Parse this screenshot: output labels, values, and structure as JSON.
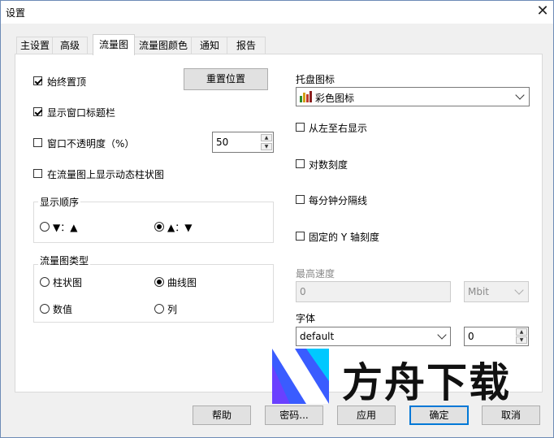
{
  "window": {
    "title": "设置",
    "close_glyph": "✕"
  },
  "tabs": [
    "主设置",
    "高级",
    "流量图",
    "流量图颜色",
    "通知",
    "报告"
  ],
  "left": {
    "always_on_top": {
      "label": "始终置顶",
      "checked": true
    },
    "reset_position_button": "重置位置",
    "show_title_bar": {
      "label": "显示窗口标题栏",
      "checked": true
    },
    "opacity": {
      "label": "窗口不透明度（%）",
      "checked": false,
      "value": "50"
    },
    "show_dynamic_bars": {
      "label": "在流量图上显示动态柱状图",
      "checked": false
    },
    "display_order": {
      "title": "显示顺序",
      "options": [
        {
          "label": "▼：▲",
          "selected": false
        },
        {
          "label": "▲：▼",
          "selected": true
        }
      ]
    },
    "graph_type": {
      "title": "流量图类型",
      "options": [
        {
          "label": "柱状图",
          "selected": false
        },
        {
          "label": "曲线图",
          "selected": true
        },
        {
          "label": "数值",
          "selected": false
        },
        {
          "label": "列",
          "selected": false
        }
      ]
    }
  },
  "right": {
    "tray_icon_label": "托盘图标",
    "tray_icon_value": "彩色图标",
    "left_to_right": {
      "label": "从左至右显示",
      "checked": false
    },
    "log_scale": {
      "label": "对数刻度",
      "checked": false
    },
    "minute_lines": {
      "label": "每分钟分隔线",
      "checked": false
    },
    "fixed_y": {
      "label": "固定的 Y 轴刻度",
      "checked": false
    },
    "max_speed_label": "最高速度",
    "max_speed_value": "0",
    "max_speed_unit": "Mbit",
    "font_label": "字体",
    "font_value": "default",
    "font_size_value": "0"
  },
  "buttons": {
    "help": "帮助",
    "password": "密码...",
    "apply": "应用",
    "ok": "确定",
    "cancel": "取消"
  },
  "watermark": {
    "text": "方舟下载",
    "accent": "#3a5cff"
  }
}
